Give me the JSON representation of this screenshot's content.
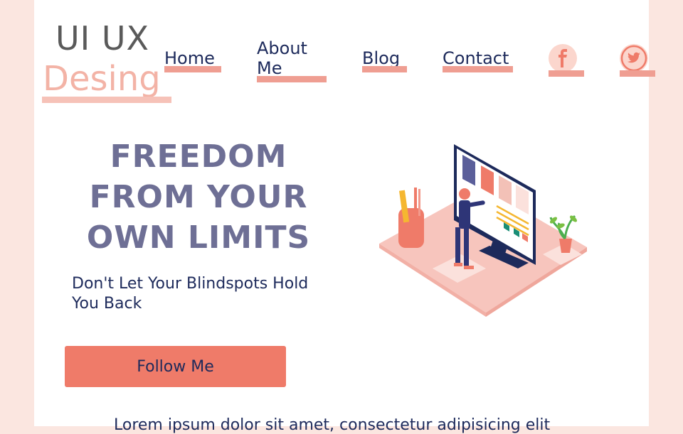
{
  "logo": {
    "line1": "UI UX",
    "line2": "Desing"
  },
  "nav": {
    "home": "Home",
    "about_line1": "About",
    "about_line2": "Me",
    "blog": "Blog",
    "contact": "Contact"
  },
  "social": {
    "facebook_icon": "facebook-icon",
    "twitter_icon": "twitter-icon"
  },
  "hero": {
    "title_line1": "FREEDOM",
    "title_line2": "FROM YOUR",
    "title_line3": "OWN LIMITS",
    "subtitle_line1": "Don't Let Your Blindspots Hold",
    "subtitle_line2": "You Back",
    "cta_label": "Follow Me"
  },
  "body": {
    "partial_text": "Lorem ipsum dolor sit amet, consectetur adipisicing elit"
  },
  "colors": {
    "background": "#fbe6e0",
    "accent": "#ef7b69",
    "underline": "#ef9e92",
    "heading": "#6e6f95",
    "navy": "#1d2a5b"
  }
}
